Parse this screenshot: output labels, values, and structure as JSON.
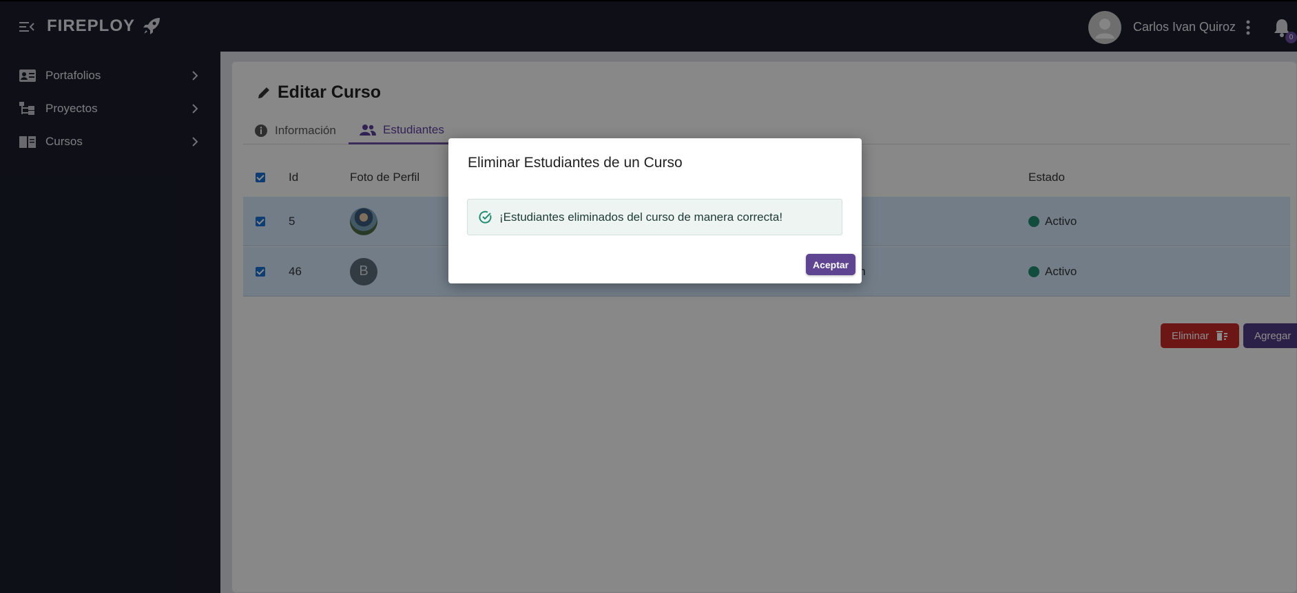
{
  "header": {
    "brand": "FIREPLOY",
    "user_name": "Carlos Ivan Quiroz",
    "notification_count": "0"
  },
  "sidebar": {
    "items": [
      {
        "label": "Portafolios",
        "icon": "id-card-icon"
      },
      {
        "label": "Proyectos",
        "icon": "sitemap-icon"
      },
      {
        "label": "Cursos",
        "icon": "book-icon"
      }
    ]
  },
  "page": {
    "title": "Editar Curso",
    "tabs": [
      {
        "label": "Información",
        "icon": "info-circle-icon"
      },
      {
        "label": "Estudiantes",
        "icon": "users-icon",
        "active": true
      }
    ]
  },
  "table": {
    "headers": {
      "id": "Id",
      "photo": "Foto de Perfil",
      "status": "Estado"
    },
    "rows": [
      {
        "id": "5",
        "avatar": "photo",
        "email_fragment": "",
        "status": "Activo"
      },
      {
        "id": "46",
        "avatar": "B",
        "email_fragment": "om",
        "status": "Activo"
      }
    ]
  },
  "actions": {
    "delete_label": "Eliminar",
    "add_label": "Agregar"
  },
  "modal": {
    "title": "Eliminar Estudiantes de un Curso",
    "message": "¡Estudiantes eliminados del curso de manera correcta!",
    "accept_label": "Aceptar"
  },
  "colors": {
    "sidebar_bg": "#1a1d2b",
    "accent": "#5f4491",
    "danger": "#c62828",
    "success": "#1f8a70",
    "row_selected": "#cfe3f8"
  }
}
